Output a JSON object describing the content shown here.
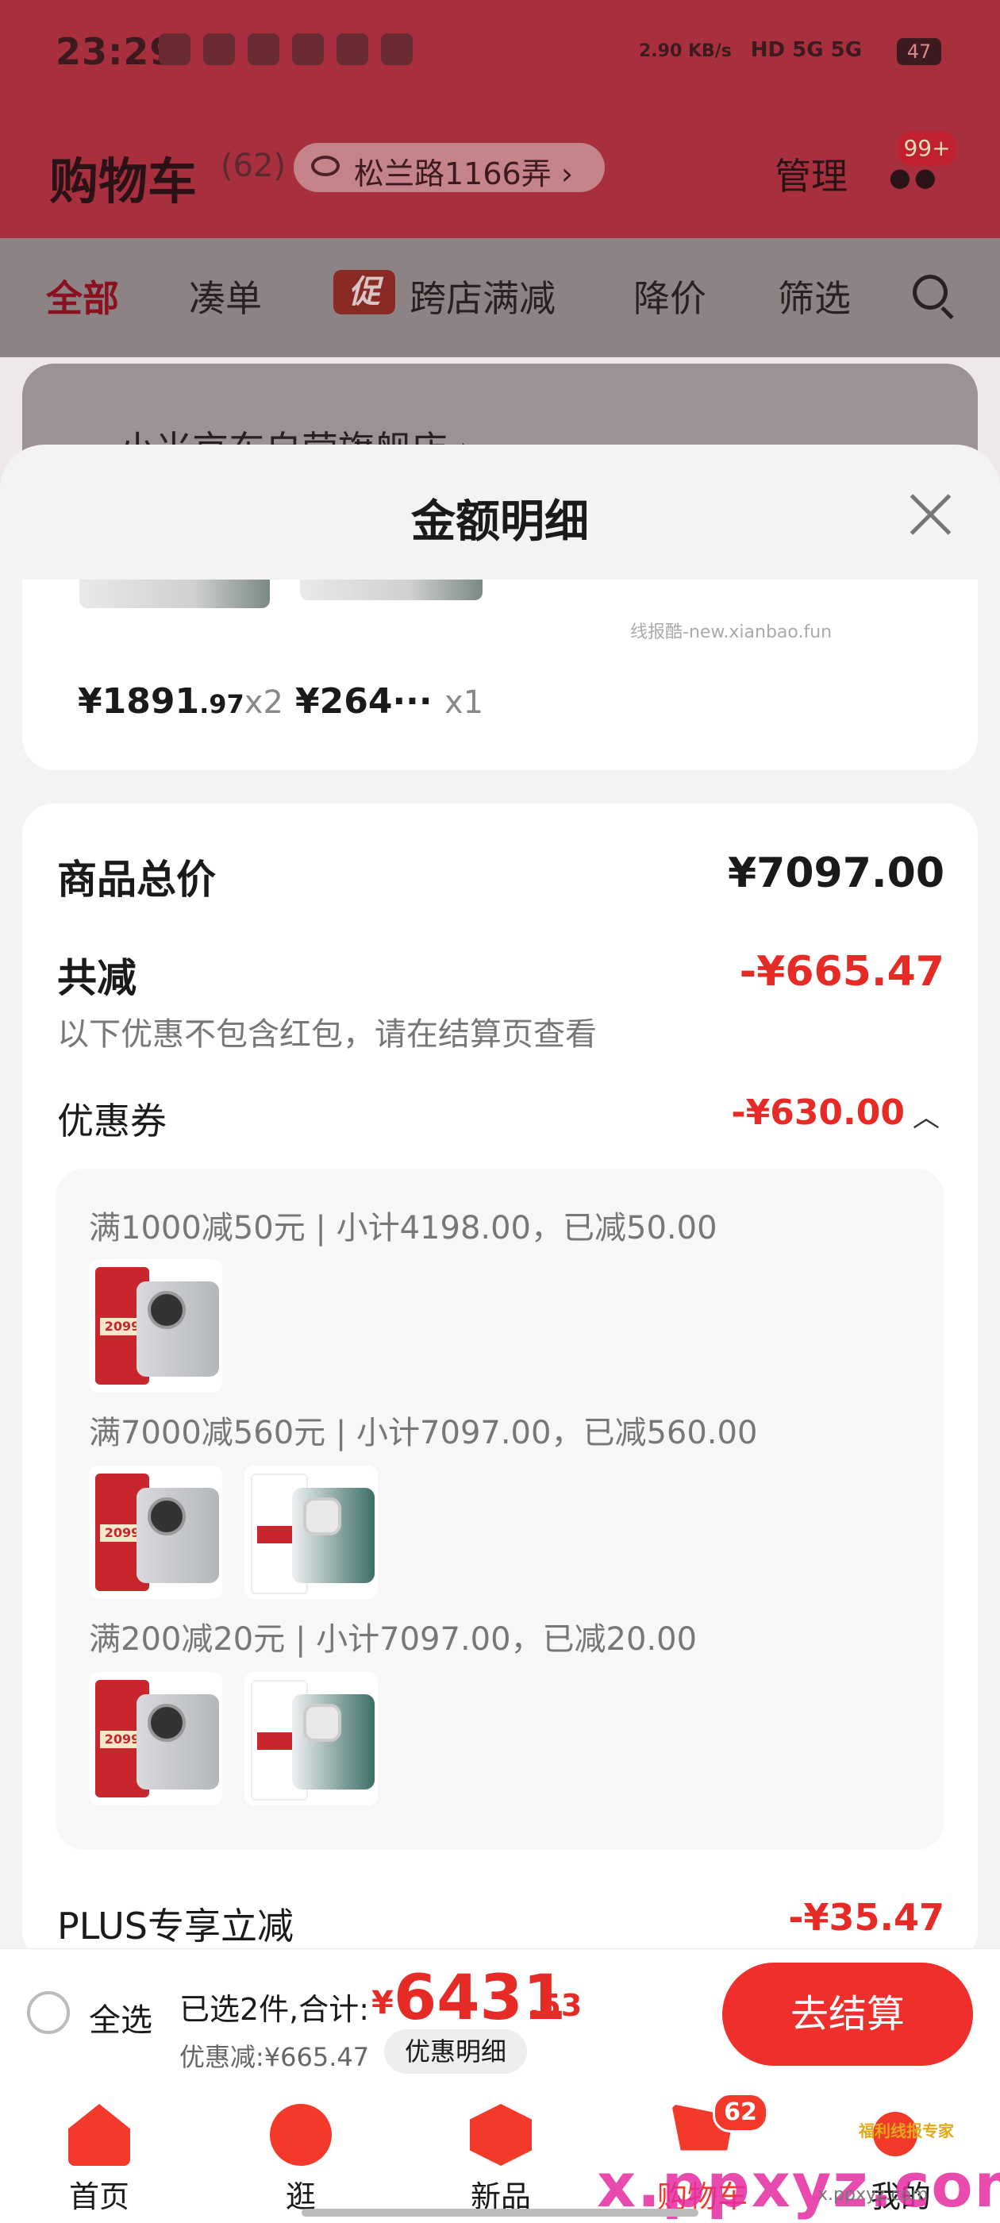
{
  "status_bar": {
    "time": "23:29",
    "net_speed": "2.90 KB/s",
    "signal": "HD 5G 5G",
    "battery": "47"
  },
  "header": {
    "title": "购物车",
    "count": "(62)",
    "address": "松兰路1166弄",
    "address_chevron": "›",
    "manage": "管理",
    "badge": "99+"
  },
  "filter_tabs": [
    {
      "label": "全部",
      "active": true
    },
    {
      "label": "凑单"
    },
    {
      "label": "跨店满减",
      "tag": "促"
    },
    {
      "label": "降价"
    },
    {
      "label": "筛选"
    }
  ],
  "background": {
    "store_name": "小米京东自营旗舰店 ›"
  },
  "sheet": {
    "title": "金额明细",
    "watermark": "线报酷-new.xianbao.fun",
    "item_prices": [
      {
        "int": "¥1891",
        "dec": ".97",
        "mult": "x2"
      },
      {
        "int": "¥264···",
        "dec": "",
        "mult": "x1"
      }
    ],
    "goods_total_label": "商品总价",
    "goods_total_value": "¥7097.00",
    "reduce_label": "共减",
    "reduce_value": "-¥665.47",
    "reduce_note": "以下优惠不包含红包，请在结算页查看",
    "coupon_label": "优惠券",
    "coupon_value": "-¥630.00",
    "coupon_rules": [
      {
        "text": "满1000减50元 | 小计4198.00，已减50.00",
        "products": [
          "Xiaomi Civi 3"
        ]
      },
      {
        "text": "满7000减560元 | 小计7097.00，已减560.00",
        "products": [
          "Xiaomi Civi 3",
          "K70 至尊版"
        ]
      },
      {
        "text": "满200减20元 | 小计7097.00，已减20.00",
        "products": [
          "Xiaomi Civi 3",
          "K70 至尊版"
        ]
      }
    ],
    "product_price_tag": "2099",
    "plus_label": "PLUS专享立减",
    "plus_value": "-¥35.47"
  },
  "checkout": {
    "select_all": "全选",
    "selected_text": "已选2件,合计:",
    "yen": "¥",
    "total_int": "6431",
    "total_dec": ".53",
    "discount_text": "优惠减:¥665.47",
    "detail_button": "优惠明细",
    "checkout_button": "去结算"
  },
  "nav": [
    {
      "label": "首页",
      "icon": "home-icon"
    },
    {
      "label": "逛",
      "icon": "browse-icon"
    },
    {
      "label": "新品",
      "icon": "new-product-icon"
    },
    {
      "label": "购物车",
      "icon": "cart-icon",
      "badge": "62"
    },
    {
      "label": "我的",
      "icon": "profile-icon"
    }
  ],
  "watermarks": {
    "big": "x.ppxyz.com",
    "small": "x.ppxyz.com",
    "green": "福利线报专家"
  }
}
